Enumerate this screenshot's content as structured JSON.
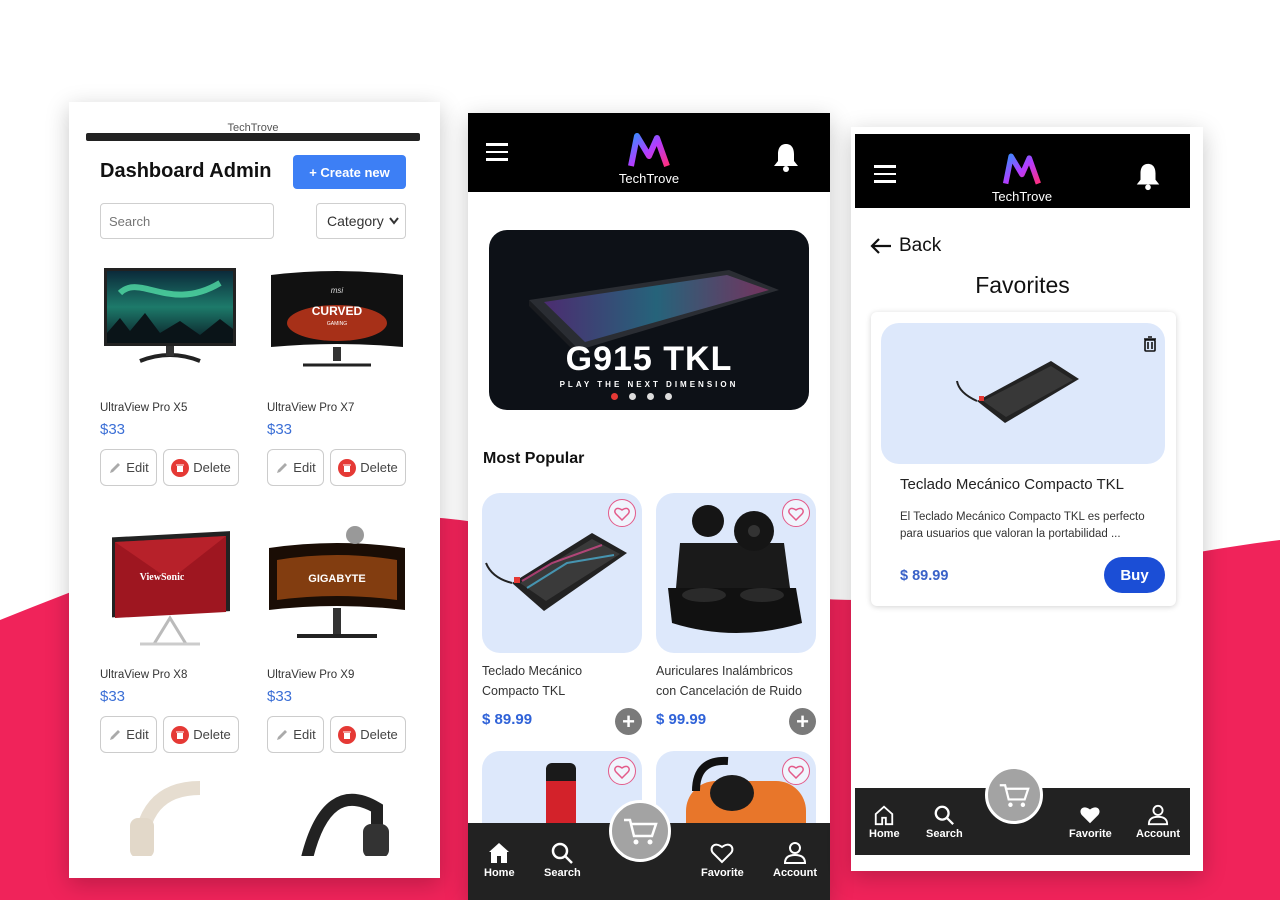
{
  "colors": {
    "accent_pink": "#f0235a",
    "primary_blue": "#3d7ff5",
    "buy_blue": "#1b4ed6",
    "price_blue": "#2f62d8",
    "header_black": "#000000",
    "tabbar": "#222222"
  },
  "admin": {
    "top_text": "TechTrove",
    "title": "Dashboard Admin",
    "create_label": "+ Create new",
    "search_placeholder": "Search",
    "category_label": "Category",
    "edit_label": "Edit",
    "delete_label": "Delete",
    "products": [
      {
        "name": "UltraView Pro X5",
        "price": "$33",
        "image": "monitor-aurora"
      },
      {
        "name": "UltraView Pro X7",
        "price": "$33",
        "image": "monitor-msi-curved"
      },
      {
        "name": "UltraView Pro X8",
        "price": "$33",
        "image": "monitor-viewsonic"
      },
      {
        "name": "UltraView Pro X9",
        "price": "$33",
        "image": "monitor-gigabyte"
      }
    ]
  },
  "shop": {
    "brand": "TechTrove",
    "banner": {
      "headline": "G915 TKL",
      "tagline": "PLAY THE NEXT DIMENSION",
      "slides": 4,
      "active_slide": 1
    },
    "section_title": "Most Popular",
    "products": [
      {
        "name": "Teclado Mecánico Compacto TKL",
        "price": "$ 89.99",
        "image": "keyboard"
      },
      {
        "name": "Auriculares Inalámbricos con Cancelación de Ruido",
        "price": "$ 99.99",
        "image": "earbuds"
      }
    ],
    "tabs": [
      {
        "label": "Home",
        "icon": "home-icon"
      },
      {
        "label": "Search",
        "icon": "search-icon"
      },
      {
        "label": "Favorite",
        "icon": "heart-icon"
      },
      {
        "label": "Account",
        "icon": "user-icon"
      }
    ]
  },
  "favorites": {
    "brand": "TechTrove",
    "back_label": "Back",
    "title": "Favorites",
    "item": {
      "name": "Teclado Mecánico Compacto TKL",
      "description": "El Teclado Mecánico Compacto TKL es perfecto para usuarios que valoran la portabilidad ...",
      "price": "$ 89.99",
      "buy_label": "Buy"
    },
    "tabs": [
      {
        "label": "Home",
        "icon": "home-icon"
      },
      {
        "label": "Search",
        "icon": "search-icon"
      },
      {
        "label": "Favorite",
        "icon": "heart-icon"
      },
      {
        "label": "Account",
        "icon": "user-icon"
      }
    ]
  }
}
